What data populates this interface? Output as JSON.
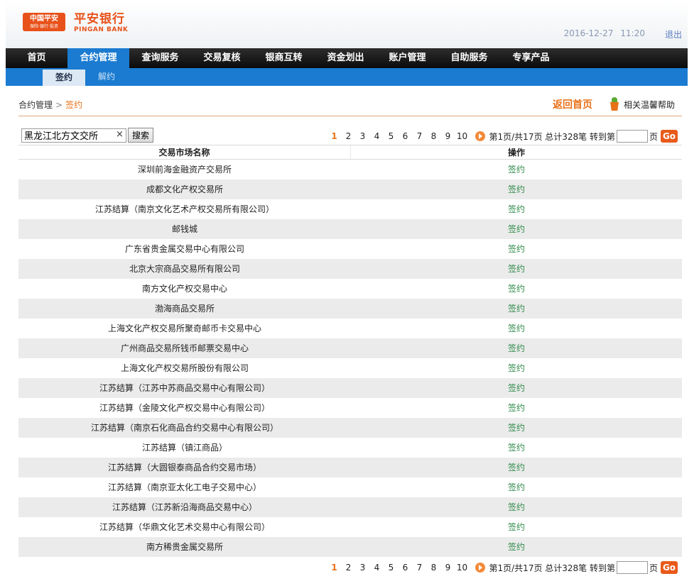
{
  "header": {
    "logo_text": "中国平安",
    "logo_sub": "保险·银行·投资",
    "brand_cn": "平安银行",
    "brand_en": "PINGAN BANK",
    "date": "2016-12-27",
    "time": "11:20",
    "logout": "退出"
  },
  "nav": {
    "items": [
      "首页",
      "合约管理",
      "查询服务",
      "交易复核",
      "银商互转",
      "资金划出",
      "账户管理",
      "自助服务",
      "专享产品"
    ],
    "active_index": 1
  },
  "subnav": {
    "items": [
      "签约",
      "解约"
    ],
    "active_index": 0
  },
  "breadcrumb": {
    "parent": "合约管理",
    "separator": ">",
    "current": "签约"
  },
  "actions": {
    "back_home": "返回首页",
    "help": "相关温馨帮助"
  },
  "search": {
    "value": "黑龙江北方文交所",
    "clear": "×",
    "button": "搜索"
  },
  "pager": {
    "pages": [
      "1",
      "2",
      "3",
      "4",
      "5",
      "6",
      "7",
      "8",
      "9",
      "10"
    ],
    "current_page": "1",
    "info": "第1页/共17页 总计328笔 转到第",
    "page_suffix": "页",
    "go": "Go"
  },
  "table": {
    "headers": [
      "交易市场名称",
      "操作"
    ],
    "rows": [
      {
        "name": "深圳前海金融资产交易所",
        "action": "签约"
      },
      {
        "name": "成都文化产权交易所",
        "action": "签约"
      },
      {
        "name": "江苏结算（南京文化艺术产权交易所有限公司）",
        "action": "签约"
      },
      {
        "name": "邮钱城",
        "action": "签约"
      },
      {
        "name": "广东省贵金属交易中心有限公司",
        "action": "签约"
      },
      {
        "name": "北京大宗商品交易所有限公司",
        "action": "签约"
      },
      {
        "name": "南方文化产权交易中心",
        "action": "签约"
      },
      {
        "name": "渤海商品交易所",
        "action": "签约"
      },
      {
        "name": "上海文化产权交易所聚奇邮币卡交易中心",
        "action": "签约"
      },
      {
        "name": "广州商品交易所钱币邮票交易中心",
        "action": "签约"
      },
      {
        "name": "上海文化产权交易所股份有限公司",
        "action": "签约"
      },
      {
        "name": "江苏结算（江苏中苏商品交易中心有限公司）",
        "action": "签约"
      },
      {
        "name": "江苏结算（金陵文化产权交易中心有限公司）",
        "action": "签约"
      },
      {
        "name": "江苏结算（南京石化商品合约交易中心有限公司）",
        "action": "签约"
      },
      {
        "name": "江苏结算（镇江商品）",
        "action": "签约"
      },
      {
        "name": "江苏结算（大圆银泰商品合约交易市场）",
        "action": "签约"
      },
      {
        "name": "江苏结算（南京亚太化工电子交易中心）",
        "action": "签约"
      },
      {
        "name": "江苏结算（江苏新沿海商品交易中心）",
        "action": "签约"
      },
      {
        "name": "江苏结算（华鼎文化艺术交易中心有限公司）",
        "action": "签约"
      },
      {
        "name": "南方稀贵金属交易所",
        "action": "签约"
      }
    ]
  },
  "colors": {
    "brand_orange": "#e8521a",
    "nav_blue": "#1a7bd1",
    "action_green": "#2f8a4a"
  }
}
